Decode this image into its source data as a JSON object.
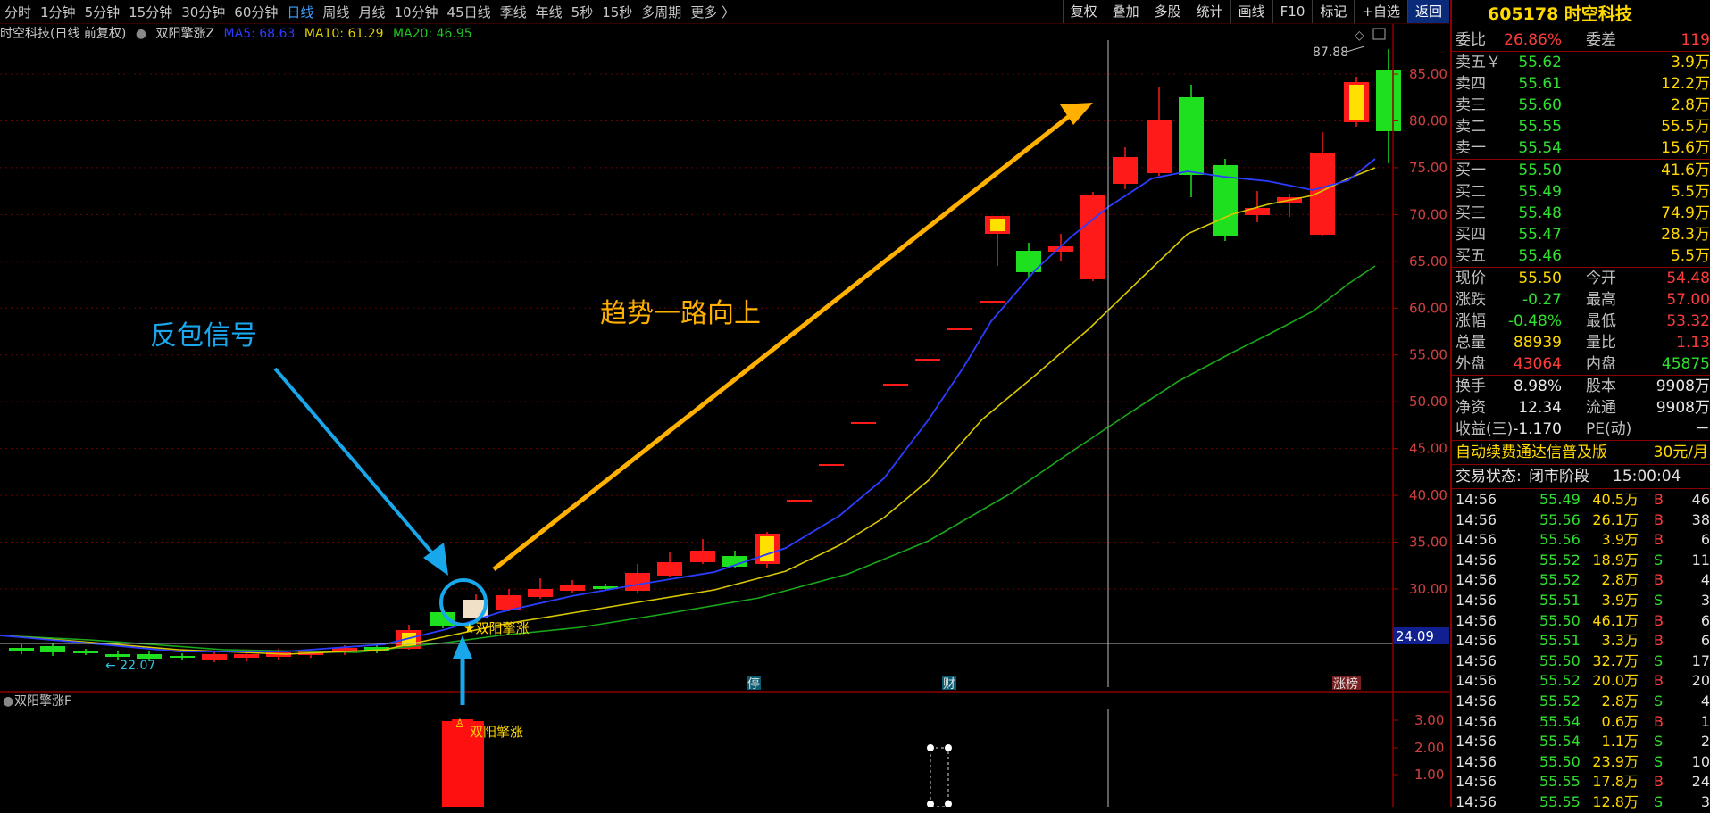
{
  "toolbar": {
    "periods": [
      "分时",
      "1分钟",
      "5分钟",
      "15分钟",
      "30分钟",
      "60分钟",
      "日线",
      "周线",
      "月线",
      "10分钟",
      "45日线",
      "季线",
      "年线",
      "5秒",
      "15秒",
      "多周期",
      "更多 〉"
    ],
    "active_index": 6,
    "right_buttons": [
      "复权",
      "叠加",
      "多股",
      "统计",
      "画线",
      "F10",
      "标记",
      "+自选",
      "返回"
    ]
  },
  "header": {
    "title": "时空科技(日线 前复权)",
    "indicator": "双阳擎涨Z",
    "ma5": "MA5: 68.63",
    "ma10": "MA10: 61.29",
    "ma20": "MA20: 46.95"
  },
  "colors": {
    "up": "#ff1a1a",
    "down": "#1fe01f",
    "ma5": "#2b3dff",
    "ma10": "#e0d000",
    "ma20": "#1aa81a",
    "accent": "#ffb000",
    "signal": "#17a7ea"
  },
  "annotations": {
    "signal_text": "反包信号",
    "trend_text": "趋势一路向上",
    "marker_label": "★双阳擎涨",
    "low_label": "← 22.07",
    "high_label": "87.88",
    "crosshair_price": "24.09",
    "events": [
      "停",
      "财",
      "涨榜"
    ]
  },
  "main_axis": {
    "ticks": [
      "85.00",
      "80.00",
      "75.00",
      "70.00",
      "65.00",
      "60.00",
      "55.00",
      "50.00",
      "45.00",
      "40.00",
      "35.00",
      "30.00"
    ]
  },
  "sub_panel": {
    "title": "双阳擎涨F",
    "label": "双阳擎涨",
    "ticks": [
      "3.00",
      "2.00",
      "1.00"
    ]
  },
  "chart_data": {
    "type": "candlestick",
    "series": [
      {
        "name": "日线"
      }
    ]
  },
  "quote": {
    "code_name": "605178 时空科技",
    "webi": {
      "label": "委比",
      "value": "26.86%",
      "label2": "委差",
      "value2": "119"
    },
    "asks": [
      {
        "label": "卖五￥",
        "price": "55.62",
        "vol": "3.9万"
      },
      {
        "label": "卖四",
        "price": "55.61",
        "vol": "12.2万"
      },
      {
        "label": "卖三",
        "price": "55.60",
        "vol": "2.8万"
      },
      {
        "label": "卖二",
        "price": "55.55",
        "vol": "55.5万"
      },
      {
        "label": "卖一",
        "price": "55.54",
        "vol": "15.6万"
      }
    ],
    "bids": [
      {
        "label": "买一",
        "price": "55.50",
        "vol": "41.6万"
      },
      {
        "label": "买二",
        "price": "55.49",
        "vol": "5.5万"
      },
      {
        "label": "买三",
        "price": "55.48",
        "vol": "74.9万"
      },
      {
        "label": "买四",
        "price": "55.47",
        "vol": "28.3万"
      },
      {
        "label": "买五",
        "price": "55.46",
        "vol": "5.5万"
      }
    ],
    "stats1": [
      {
        "l": "现价",
        "v": "55.50",
        "vc": "yellow",
        "l2": "今开",
        "v2": "54.48",
        "v2c": "red"
      },
      {
        "l": "涨跌",
        "v": "-0.27",
        "vc": "green",
        "l2": "最高",
        "v2": "57.00",
        "v2c": "red"
      },
      {
        "l": "涨幅",
        "v": "-0.48%",
        "vc": "green",
        "l2": "最低",
        "v2": "53.32",
        "v2c": "red"
      },
      {
        "l": "总量",
        "v": "88939",
        "vc": "yellow",
        "l2": "量比",
        "v2": "1.13",
        "v2c": "red"
      },
      {
        "l": "外盘",
        "v": "43064",
        "vc": "red",
        "l2": "内盘",
        "v2": "45875",
        "v2c": "green"
      }
    ],
    "stats2": [
      {
        "l": "换手",
        "v": "8.98%",
        "l2": "股本",
        "v2": "9908万"
      },
      {
        "l": "净资",
        "v": "12.34",
        "l2": "流通",
        "v2": "9908万"
      },
      {
        "l": "收益(三)",
        "v": "-1.170",
        "l2": "PE(动)",
        "v2": "－"
      }
    ],
    "promo": {
      "text": "自动续费通达信普及版",
      "price": "30元/月"
    },
    "status": {
      "label": "交易状态:",
      "value": "闭市阶段",
      "time": "15:00:04"
    },
    "ticks": [
      {
        "t": "14:56",
        "p": "55.49",
        "v": "40.5万",
        "s": "B",
        "n": "46"
      },
      {
        "t": "14:56",
        "p": "55.56",
        "v": "26.1万",
        "s": "B",
        "n": "38"
      },
      {
        "t": "14:56",
        "p": "55.56",
        "v": "3.9万",
        "s": "B",
        "n": "6"
      },
      {
        "t": "14:56",
        "p": "55.52",
        "v": "18.9万",
        "s": "S",
        "n": "11"
      },
      {
        "t": "14:56",
        "p": "55.52",
        "v": "2.8万",
        "s": "B",
        "n": "4"
      },
      {
        "t": "14:56",
        "p": "55.51",
        "v": "3.9万",
        "s": "S",
        "n": "3"
      },
      {
        "t": "14:56",
        "p": "55.50",
        "v": "46.1万",
        "s": "B",
        "n": "6"
      },
      {
        "t": "14:56",
        "p": "55.51",
        "v": "3.3万",
        "s": "B",
        "n": "6"
      },
      {
        "t": "14:56",
        "p": "55.50",
        "v": "32.7万",
        "s": "S",
        "n": "17"
      },
      {
        "t": "14:56",
        "p": "55.52",
        "v": "20.0万",
        "s": "B",
        "n": "20"
      },
      {
        "t": "14:56",
        "p": "55.52",
        "v": "2.8万",
        "s": "S",
        "n": "4"
      },
      {
        "t": "14:56",
        "p": "55.54",
        "v": "0.6万",
        "s": "B",
        "n": "1"
      },
      {
        "t": "14:56",
        "p": "55.54",
        "v": "1.1万",
        "s": "S",
        "n": "2"
      },
      {
        "t": "14:56",
        "p": "55.50",
        "v": "23.9万",
        "s": "S",
        "n": "10"
      },
      {
        "t": "14:56",
        "p": "55.55",
        "v": "17.8万",
        "s": "B",
        "n": "24"
      },
      {
        "t": "14:56",
        "p": "55.55",
        "v": "12.8万",
        "s": "S",
        "n": "3"
      }
    ]
  }
}
